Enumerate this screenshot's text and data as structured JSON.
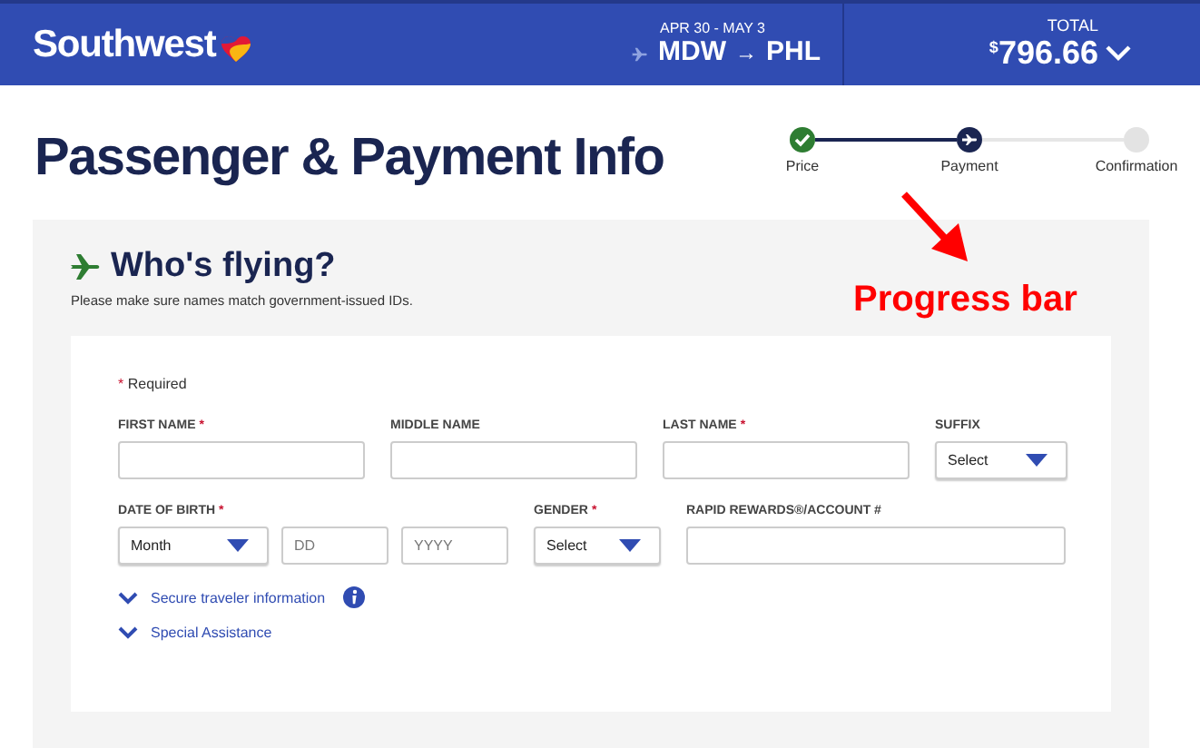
{
  "header": {
    "logo": "Southwest",
    "dates": "APR 30 - MAY 3",
    "origin": "MDW",
    "arrow": "→",
    "destination": "PHL",
    "total_label": "TOTAL",
    "currency": "$",
    "total": "796.66"
  },
  "page_title": "Passenger & Payment Info",
  "progress": [
    {
      "label": "Price",
      "kind": "complete"
    },
    {
      "label": "Payment",
      "kind": "current"
    },
    {
      "label": "Confirmation",
      "kind": "upcoming"
    }
  ],
  "annotation": {
    "text": "Progress bar"
  },
  "section": {
    "title": "Who's flying?",
    "subtitle": "Please make sure names match government-issued IDs.",
    "required_legend": {
      "mark": "*",
      "text": "Required"
    },
    "rows": [
      {
        "fields": [
          {
            "label": "FIRST NAME",
            "required": true,
            "inputs": [
              {
                "kind": "text"
              }
            ]
          },
          {
            "label": "MIDDLE NAME",
            "required": false,
            "inputs": [
              {
                "kind": "text"
              }
            ]
          },
          {
            "label": "LAST NAME",
            "required": true,
            "inputs": [
              {
                "kind": "text"
              }
            ]
          },
          {
            "label": "SUFFIX",
            "required": false,
            "inputs": [
              {
                "kind": "select",
                "value": "Select"
              }
            ]
          }
        ]
      },
      {
        "fields": [
          {
            "label": "DATE OF BIRTH",
            "required": true,
            "inputs": [
              {
                "kind": "select",
                "value": "Month"
              },
              {
                "kind": "text",
                "placeholder": "DD"
              },
              {
                "kind": "text",
                "placeholder": "YYYY"
              }
            ]
          },
          {
            "label": "GENDER",
            "required": true,
            "inputs": [
              {
                "kind": "select",
                "value": "Select"
              }
            ]
          },
          {
            "label": "RAPID REWARDS®/ACCOUNT #",
            "required": false,
            "inputs": [
              {
                "kind": "text"
              }
            ]
          }
        ]
      }
    ],
    "links": [
      {
        "label": "Secure traveler information",
        "info": true,
        "expanded": false
      },
      {
        "label": "Special Assistance",
        "info": false,
        "expanded": false
      }
    ]
  }
}
